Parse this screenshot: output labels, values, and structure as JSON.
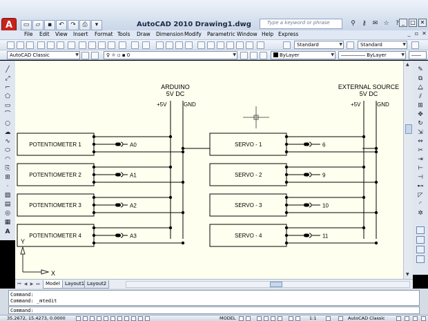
{
  "window": {
    "app_button_label": "A",
    "title": "AutoCAD 2010    Drawing1.dwg",
    "search_placeholder": "Type a keyword or phrase",
    "win_min": "_",
    "win_max": "□",
    "win_close": "✕",
    "doc_min": "_",
    "doc_max": "▫",
    "doc_close": "✕"
  },
  "menu": [
    "File",
    "Edit",
    "View",
    "Insert",
    "Format",
    "Tools",
    "Draw",
    "Dimension",
    "Modify",
    "Parametric",
    "Window",
    "Help",
    "Express"
  ],
  "toolbar": {
    "text_style": "Standard",
    "dim_style": "Standard",
    "workspace": "AutoCAD Classic",
    "layer": "0",
    "color": "ByLayer",
    "linetype": "ByLayer"
  },
  "drawing": {
    "arduino_title": "ARDUINO",
    "arduino_sub": "5V DC",
    "ext_title": "EXTERNAL SOURCE",
    "ext_sub": "5V DC",
    "plus5v": "+5V",
    "gnd": "GND",
    "pots": [
      {
        "label": "POTENTIOMETER 1",
        "pin": "A0"
      },
      {
        "label": "POTENTIOMETER 2",
        "pin": "A1"
      },
      {
        "label": "POTENTIOMETER 3",
        "pin": "A2"
      },
      {
        "label": "POTENTIOMETER 4",
        "pin": "A3"
      }
    ],
    "servos": [
      {
        "label": "SERVO - 1",
        "pin": "6"
      },
      {
        "label": "SERVO - 2",
        "pin": "9"
      },
      {
        "label": "SERVO - 3",
        "pin": "10"
      },
      {
        "label": "SERVO - 4",
        "pin": "11"
      }
    ],
    "ucs_x": "X",
    "ucs_y": "Y"
  },
  "layout_tabs": [
    "Model",
    "Layout1",
    "Layout2"
  ],
  "command": {
    "line1": "Command:",
    "line2": "Command:  _mtedit",
    "prompt": "Command:"
  },
  "status": {
    "coords": "35.2672, 15.4273, 0.0000",
    "model": "MODEL",
    "scale": "1:1",
    "workspace": "AutoCAD Classic"
  },
  "colors": {
    "canvas_bg": "#ffffef",
    "title_gradient_top": "#eef3fa",
    "app_button": "#c8221c"
  }
}
